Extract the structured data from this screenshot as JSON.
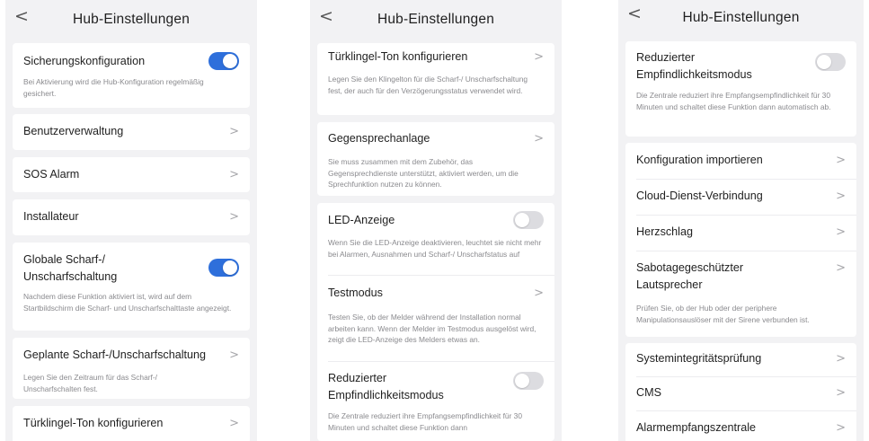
{
  "common": {
    "title": "Hub-Einstellungen",
    "back_glyph": "<",
    "chevron_glyph": ">",
    "accent_color": "#2e6fdb"
  },
  "screen1": {
    "backup": {
      "label": "Sicherungskonfiguration",
      "toggle": "on",
      "desc": "Bei Aktivierung wird die Hub-Konfiguration regelmäßig gesichert."
    },
    "user_management": "Benutzerverwaltung",
    "sos_alarm": "SOS Alarm",
    "installer": "Installateur",
    "global_arm": {
      "label_line1": "Globale Scharf-/",
      "label_line2": "Unscharfschaltung",
      "toggle": "on",
      "desc": "Nachdem diese Funktion aktiviert ist, wird auf dem Startbildschirm die Scharf- und Unscharfschalttaste angezeigt."
    },
    "scheduled_arm": {
      "label": "Geplante Scharf-/Unscharfschaltung",
      "desc": "Legen Sie den Zeitraum für das Scharf-/ Unscharfschalten fest."
    },
    "doorbell": "Türklingel-Ton konfigurieren"
  },
  "screen2": {
    "doorbell": {
      "label": "Türklingel-Ton konfigurieren",
      "desc": "Legen Sie den Klingelton für die Scharf-/ Unscharfschaltung fest, der auch für den Verzögerungsstatus verwendet wird."
    },
    "intercom": {
      "label": "Gegensprechanlage",
      "desc": "Sie muss zusammen mit dem Zubehör, das Gegensprechdienste unterstützt, aktiviert werden, um die Sprechfunktion nutzen zu können."
    },
    "led": {
      "label": "LED-Anzeige",
      "toggle": "off",
      "desc": "Wenn Sie die LED-Anzeige deaktivieren, leuchtet sie nicht mehr bei Alarmen, Ausnahmen und Scharf-/ Unscharfstatus auf"
    },
    "test_mode": {
      "label": "Testmodus",
      "desc": "Testen Sie, ob der Melder während der Installation normal arbeiten kann. Wenn der Melder im Testmodus ausgelöst wird, zeigt die LED-Anzeige des Melders etwas an."
    },
    "reduced_sensitivity": {
      "label_line1": "Reduzierter",
      "label_line2": "Empfindlichkeitsmodus",
      "toggle": "off",
      "desc": "Die Zentrale reduziert ihre Empfangsempfindlichkeit für 30 Minuten und schaltet diese Funktion dann"
    }
  },
  "screen3": {
    "reduced_sensitivity": {
      "label_line1": "Reduzierter",
      "label_line2": "Empfindlichkeitsmodus",
      "toggle": "off",
      "desc": "Die Zentrale reduziert ihre Empfangsempfindlichkeit für 30 Minuten und schaltet diese Funktion dann automatisch ab."
    },
    "import_config": "Konfiguration importieren",
    "cloud_connection": "Cloud-Dienst-Verbindung",
    "heartbeat": "Herzschlag",
    "tamper_speaker": {
      "label_line1": "Sabotagegeschützter",
      "label_line2": "Lautsprecher",
      "desc": "Prüfen Sie, ob der Hub oder der periphere Manipulationsauslöser mit der Sirene verbunden ist."
    },
    "integrity_check": "Systemintegritätsprüfung",
    "cms": "CMS",
    "alarm_center": "Alarmempfangszentrale"
  }
}
